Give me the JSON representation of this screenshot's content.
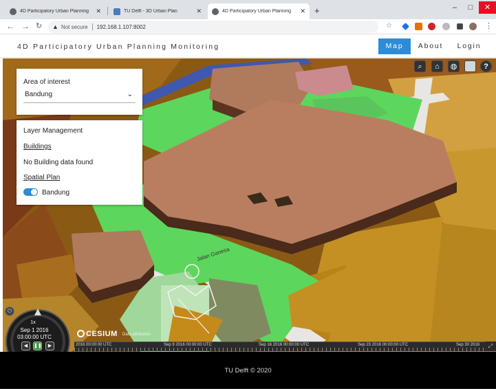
{
  "browser": {
    "tabs": [
      {
        "title": "4D Participatory Urban Planning"
      },
      {
        "title": "TU Delft - 3D Urban Plan"
      },
      {
        "title": "4D Participatory Urban Planning"
      }
    ],
    "security_label": "Not secure",
    "url": "192.168.1.107:8002"
  },
  "app": {
    "title": "4D Participatory Urban Planning Monitoring",
    "nav": {
      "map": "Map",
      "about": "About",
      "login": "Login"
    }
  },
  "aoi": {
    "label": "Area of interest",
    "selected": "Bandung"
  },
  "layers": {
    "title": "Layer Management",
    "buildings_link": "Buildings",
    "buildings_status": "No Building data found",
    "spatial_plan_link": "Spatial Plan",
    "spatial_plan_layer": "Bandung",
    "spatial_plan_enabled": true
  },
  "map": {
    "street_label": "Jalan Ganesa",
    "toolbar_icons": [
      "search-icon",
      "home-icon",
      "globe-icon",
      "base-layer-picker-icon",
      "help-icon"
    ]
  },
  "cesium": {
    "speed": "1x",
    "date": "Sep 1 2016",
    "time": "03:00:00 UTC",
    "logo": "CESIUM",
    "attribution": "Data attribution",
    "timeline_labels": [
      "2016 00:00:00 UTC",
      "Sep 9 2016 00:00:00 UTC",
      "Sep 16 2016 00:00:00 UTC",
      "Sep 23 2016 00:00:00 UTC",
      "Sep 30 2016"
    ]
  },
  "footer": {
    "text": "TU Delft © 2020"
  },
  "colors": {
    "accent": "#2e8bd8",
    "green_space": "#5dd65d",
    "buildings": "#b87a5c",
    "landuse": "#c48a1a"
  }
}
